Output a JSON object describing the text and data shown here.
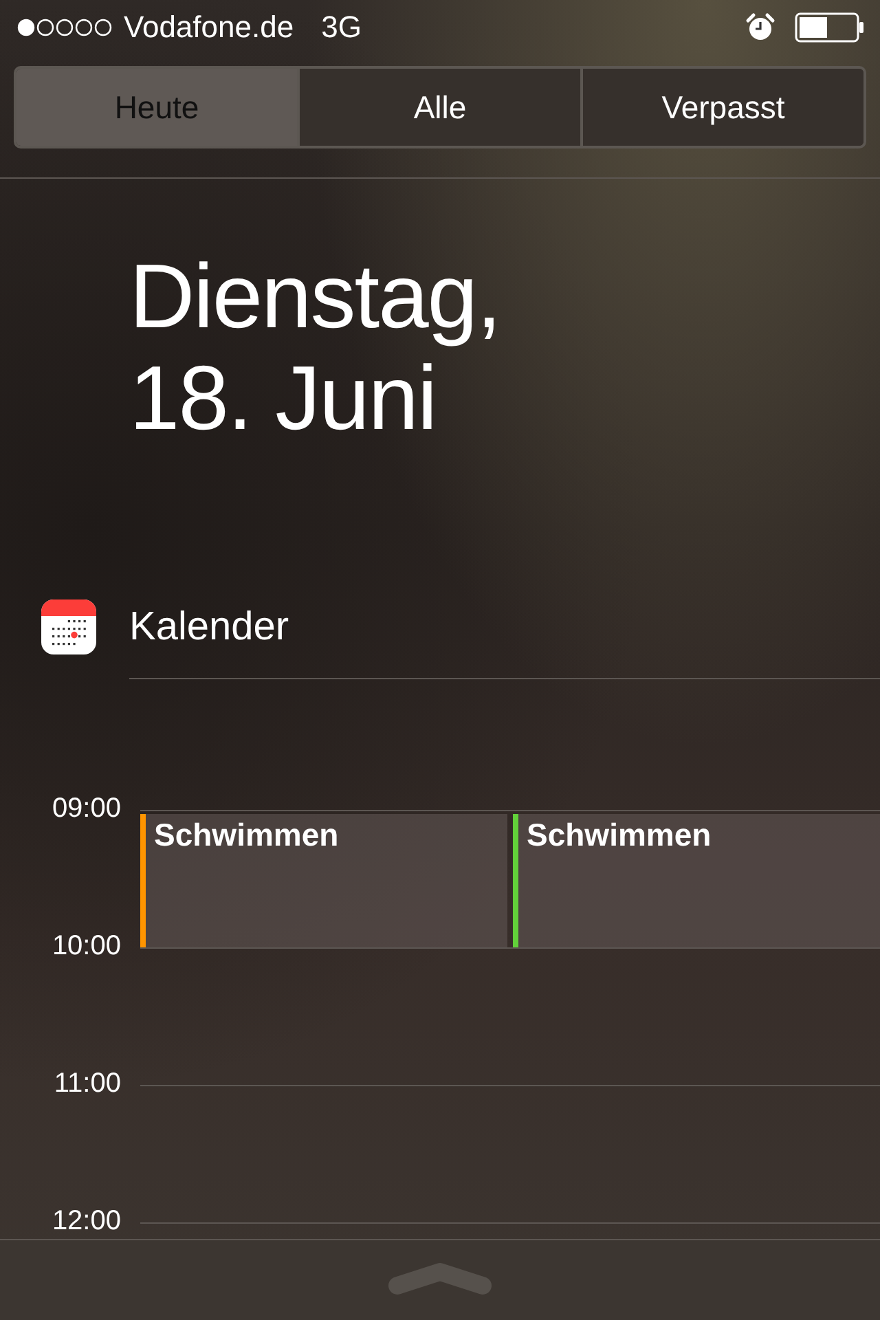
{
  "status_bar": {
    "carrier": "Vodafone.de",
    "network": "3G"
  },
  "tabs": [
    {
      "label": "Heute",
      "selected": true
    },
    {
      "label": "Alle",
      "selected": false
    },
    {
      "label": "Verpasst",
      "selected": false
    }
  ],
  "date": {
    "weekday": "Dienstag,",
    "day": "18. Juni"
  },
  "calendar": {
    "title": "Kalender",
    "hours": [
      {
        "label": "09:00",
        "events": [
          {
            "title": "Schwimmen",
            "color": "#ff9500"
          },
          {
            "title": "Schwimmen",
            "color": "#62d13a"
          }
        ]
      },
      {
        "label": "10:00"
      },
      {
        "label": "11:00"
      },
      {
        "label": "12:00"
      }
    ]
  }
}
